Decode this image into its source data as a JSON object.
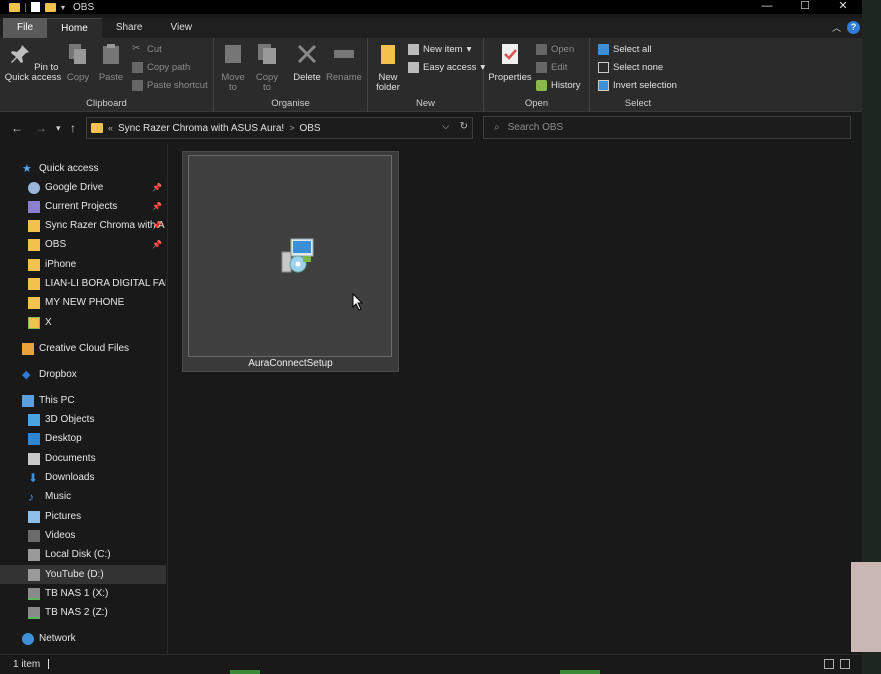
{
  "window": {
    "title": "OBS"
  },
  "titlebar": {
    "minimize": "—",
    "maximize": "☐",
    "close": "✕"
  },
  "tabs": [
    {
      "label": "File"
    },
    {
      "label": "Home"
    },
    {
      "label": "Share"
    },
    {
      "label": "View"
    }
  ],
  "ribbon": {
    "clipboard": {
      "label": "Clipboard",
      "pin": "Pin to Quick access",
      "copy": "Copy",
      "paste": "Paste",
      "cut": "Cut",
      "copy_path": "Copy path",
      "paste_shortcut": "Paste shortcut"
    },
    "organise": {
      "label": "Organise",
      "move_to": "Move to",
      "copy_to": "Copy to",
      "delete": "Delete",
      "rename": "Rename"
    },
    "new": {
      "label": "New",
      "new_folder": "New folder",
      "new_item": "New item",
      "easy_access": "Easy access"
    },
    "open": {
      "label": "Open",
      "properties": "Properties",
      "open": "Open",
      "edit": "Edit",
      "history": "History"
    },
    "select": {
      "label": "Select",
      "select_all": "Select all",
      "select_none": "Select none",
      "invert_selection": "Invert selection"
    }
  },
  "address": {
    "overflow": "«",
    "crumbs": [
      "Sync Razer Chroma with ASUS Aura!",
      "OBS"
    ],
    "sep": ">",
    "search_placeholder": "Search OBS"
  },
  "nav": {
    "quick_access": "Quick access",
    "quick_items": [
      {
        "label": "Google Drive",
        "pinned": true
      },
      {
        "label": "Current Projects",
        "pinned": true
      },
      {
        "label": "Sync Razer Chroma with A",
        "pinned": true
      },
      {
        "label": "OBS",
        "pinned": true
      },
      {
        "label": "iPhone"
      },
      {
        "label": "LIAN-LI BORA DIGITAL FANS"
      },
      {
        "label": "MY NEW PHONE"
      },
      {
        "label": "X"
      }
    ],
    "creative_cloud": "Creative Cloud Files",
    "dropbox": "Dropbox",
    "this_pc": "This PC",
    "pc_items": [
      {
        "label": "3D Objects"
      },
      {
        "label": "Desktop"
      },
      {
        "label": "Documents"
      },
      {
        "label": "Downloads"
      },
      {
        "label": "Music"
      },
      {
        "label": "Pictures"
      },
      {
        "label": "Videos"
      },
      {
        "label": "Local Disk (C:)"
      },
      {
        "label": "YouTube (D:)"
      },
      {
        "label": "TB NAS 1 (X:)"
      },
      {
        "label": "TB NAS 2 (Z:)"
      }
    ],
    "network": "Network"
  },
  "files": [
    {
      "name": "AuraConnectSetup"
    }
  ],
  "status": {
    "items": "1 item"
  },
  "colors": {
    "folder": "#f2c14e",
    "accent_blue": "#2e7bd6",
    "background": "#191919"
  }
}
